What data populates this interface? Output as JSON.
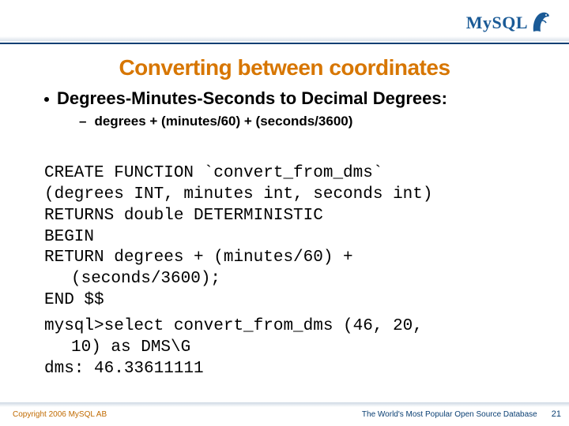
{
  "brand": {
    "name": "MySQL"
  },
  "title": "Converting between coordinates",
  "bullet1": "Degrees-Minutes-Seconds to Decimal Degrees:",
  "bullet2_prefix": "–",
  "bullet2": "degrees + (minutes/60) + (seconds/3600)",
  "code": {
    "l1": "CREATE FUNCTION `convert_from_dms`",
    "l2": "(degrees INT, minutes int, seconds int)",
    "l3": "RETURNS double DETERMINISTIC",
    "l4": "BEGIN",
    "l5": "RETURN degrees + (minutes/60) +",
    "l5b": "(seconds/3600);",
    "l6": "END $$",
    "l7": "mysql>select convert_from_dms (46, 20,",
    "l7b": "10) as DMS\\G",
    "l8": "dms: 46.33611111"
  },
  "footer": {
    "copyright": "Copyright 2006 MySQL AB",
    "tagline": "The World's Most Popular Open Source Database",
    "page": "21"
  }
}
